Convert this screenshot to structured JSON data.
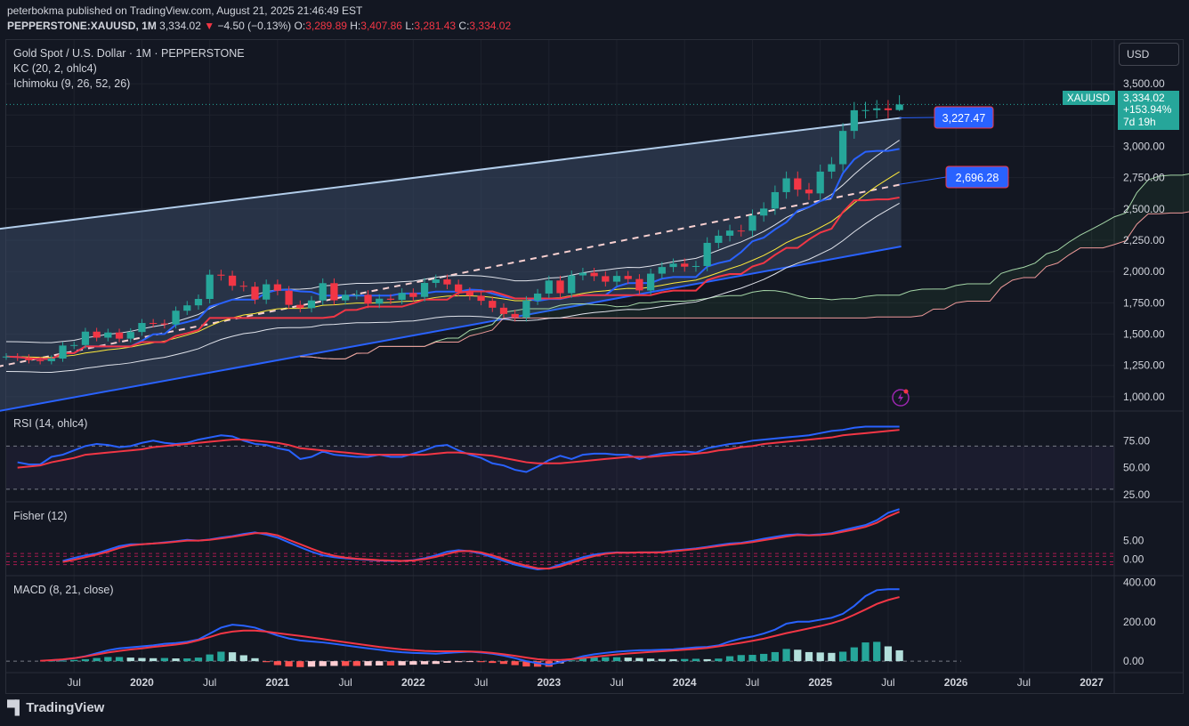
{
  "header": {
    "published_line": "peterbokma published on TradingView.com, August 21, 2025 21:46:49 EST",
    "symbol": "PEPPERSTONE:XAUUSD, 1M",
    "last": "3,334.02",
    "change_arrow": "▼",
    "change": "−4.50 (−0.13%)",
    "o_label": "O:",
    "o_value": "3,289.89",
    "h_label": "H:",
    "h_value": "3,407.86",
    "l_label": "L:",
    "l_value": "3,281.43",
    "c_label": "C:",
    "c_value": "3,334.02"
  },
  "legend": {
    "title": "Gold Spot / U.S. Dollar · 1M · PEPPERSTONE",
    "kc": "KC (20, 2, ohlc4)",
    "ichimoku": "Ichimoku (9, 26, 52, 26)",
    "rsi": "RSI (14, ohlc4)",
    "fisher": "Fisher (12)",
    "macd": "MACD (8, 21, close)"
  },
  "currency_button": "USD",
  "price_tag": {
    "symbol": "XAUUSD",
    "price": "3,334.02",
    "change_pct": "+153.94%",
    "countdown": "7d 19h"
  },
  "annotations": {
    "upper_line_value": "3,227.47",
    "mid_line_value": "2,696.28"
  },
  "colors": {
    "background": "#131722",
    "up": "#26a69a",
    "down": "#f23645",
    "blue_line": "#2962ff",
    "red_line": "#f23645",
    "channel_upper": "#b2cdea",
    "channel_fill": "#3a4a66"
  },
  "footer": {
    "logo_text": "TradingView"
  },
  "chart_data": [
    {
      "type": "candlestick",
      "title": "Gold Spot / U.S. Dollar · 1M · PEPPERSTONE",
      "ylim": [
        900,
        3600
      ],
      "y_ticks": [
        "3,500.00",
        "3,250.00",
        "3,000.00",
        "2,750.00",
        "2,500.00",
        "2,250.00",
        "2,000.00",
        "1,750.00",
        "1,500.00",
        "1,250.00",
        "1,000.00"
      ],
      "y_tick_values": [
        3500,
        3250,
        3000,
        2750,
        2500,
        2250,
        2000,
        1750,
        1500,
        1250,
        1000
      ],
      "x_ticks": [
        "Jul",
        "2020",
        "Jul",
        "2021",
        "Jul",
        "2022",
        "Jul",
        "2023",
        "Jul",
        "2024",
        "Jul",
        "2025",
        "Jul",
        "2026",
        "Jul",
        "2027"
      ],
      "x_tick_months": [
        "2019-07",
        "2020-01",
        "2020-07",
        "2021-01",
        "2021-07",
        "2022-01",
        "2022-07",
        "2023-01",
        "2023-07",
        "2024-01",
        "2024-07",
        "2025-01",
        "2025-07",
        "2026-01",
        "2026-07",
        "2027-01"
      ],
      "x_range": [
        "2019-01",
        "2027-03"
      ],
      "closes": [
        {
          "month": "2019-01",
          "close": 1321
        },
        {
          "month": "2019-02",
          "close": 1313
        },
        {
          "month": "2019-03",
          "close": 1292
        },
        {
          "month": "2019-04",
          "close": 1284
        },
        {
          "month": "2019-05",
          "close": 1305
        },
        {
          "month": "2019-06",
          "close": 1409
        },
        {
          "month": "2019-07",
          "close": 1413
        },
        {
          "month": "2019-08",
          "close": 1520
        },
        {
          "month": "2019-09",
          "close": 1472
        },
        {
          "month": "2019-10",
          "close": 1513
        },
        {
          "month": "2019-11",
          "close": 1464
        },
        {
          "month": "2019-12",
          "close": 1517
        },
        {
          "month": "2020-01",
          "close": 1589
        },
        {
          "month": "2020-02",
          "close": 1585
        },
        {
          "month": "2020-03",
          "close": 1577
        },
        {
          "month": "2020-04",
          "close": 1687
        },
        {
          "month": "2020-05",
          "close": 1730
        },
        {
          "month": "2020-06",
          "close": 1781
        },
        {
          "month": "2020-07",
          "close": 1975
        },
        {
          "month": "2020-08",
          "close": 1967
        },
        {
          "month": "2020-09",
          "close": 1886
        },
        {
          "month": "2020-10",
          "close": 1879
        },
        {
          "month": "2020-11",
          "close": 1776
        },
        {
          "month": "2020-12",
          "close": 1898
        },
        {
          "month": "2021-01",
          "close": 1847
        },
        {
          "month": "2021-02",
          "close": 1734
        },
        {
          "month": "2021-03",
          "close": 1708
        },
        {
          "month": "2021-04",
          "close": 1769
        },
        {
          "month": "2021-05",
          "close": 1907
        },
        {
          "month": "2021-06",
          "close": 1770
        },
        {
          "month": "2021-07",
          "close": 1814
        },
        {
          "month": "2021-08",
          "close": 1814
        },
        {
          "month": "2021-09",
          "close": 1743
        },
        {
          "month": "2021-10",
          "close": 1783
        },
        {
          "month": "2021-11",
          "close": 1774
        },
        {
          "month": "2021-12",
          "close": 1829
        },
        {
          "month": "2022-01",
          "close": 1797
        },
        {
          "month": "2022-02",
          "close": 1909
        },
        {
          "month": "2022-03",
          "close": 1937
        },
        {
          "month": "2022-04",
          "close": 1897
        },
        {
          "month": "2022-05",
          "close": 1837
        },
        {
          "month": "2022-06",
          "close": 1807
        },
        {
          "month": "2022-07",
          "close": 1766
        },
        {
          "month": "2022-08",
          "close": 1711
        },
        {
          "month": "2022-09",
          "close": 1661
        },
        {
          "month": "2022-10",
          "close": 1633
        },
        {
          "month": "2022-11",
          "close": 1768
        },
        {
          "month": "2022-12",
          "close": 1824
        },
        {
          "month": "2023-01",
          "close": 1928
        },
        {
          "month": "2023-02",
          "close": 1827
        },
        {
          "month": "2023-03",
          "close": 1969
        },
        {
          "month": "2023-04",
          "close": 1990
        },
        {
          "month": "2023-05",
          "close": 1963
        },
        {
          "month": "2023-06",
          "close": 1919
        },
        {
          "month": "2023-07",
          "close": 1965
        },
        {
          "month": "2023-08",
          "close": 1940
        },
        {
          "month": "2023-09",
          "close": 1849
        },
        {
          "month": "2023-10",
          "close": 1983
        },
        {
          "month": "2023-11",
          "close": 2036
        },
        {
          "month": "2023-12",
          "close": 2063
        },
        {
          "month": "2024-01",
          "close": 2039
        },
        {
          "month": "2024-02",
          "close": 2044
        },
        {
          "month": "2024-03",
          "close": 2229
        },
        {
          "month": "2024-04",
          "close": 2286
        },
        {
          "month": "2024-05",
          "close": 2327
        },
        {
          "month": "2024-06",
          "close": 2326
        },
        {
          "month": "2024-07",
          "close": 2447
        },
        {
          "month": "2024-08",
          "close": 2503
        },
        {
          "month": "2024-09",
          "close": 2634
        },
        {
          "month": "2024-10",
          "close": 2744
        },
        {
          "month": "2024-11",
          "close": 2654
        },
        {
          "month": "2024-12",
          "close": 2624
        },
        {
          "month": "2025-01",
          "close": 2798
        },
        {
          "month": "2025-02",
          "close": 2857
        },
        {
          "month": "2025-03",
          "close": 3123
        },
        {
          "month": "2025-04",
          "close": 3288
        },
        {
          "month": "2025-05",
          "close": 3289
        },
        {
          "month": "2025-06",
          "close": 3303
        },
        {
          "month": "2025-07",
          "close": 3289
        },
        {
          "month": "2025-08",
          "close": 3334
        }
      ],
      "last_candle": {
        "open": 3289.89,
        "high": 3407.86,
        "low": 3281.43,
        "close": 3334.02
      }
    },
    {
      "type": "line",
      "title": "RSI (14, ohlc4)",
      "ylim": [
        20,
        100
      ],
      "y_ticks": [
        "75.00",
        "50.00",
        "25.00"
      ],
      "y_tick_values": [
        75,
        50,
        25
      ],
      "band": [
        30,
        70
      ],
      "series": [
        {
          "values": [
            55,
            53,
            53,
            60,
            62,
            66,
            70,
            72,
            71,
            69,
            70,
            73,
            75,
            73,
            72,
            73,
            76,
            78,
            80,
            79,
            75,
            72,
            71,
            68,
            66,
            58,
            60,
            65,
            62,
            61,
            60,
            60,
            62,
            60,
            60,
            63,
            66,
            70,
            71,
            66,
            62,
            59,
            54,
            52,
            48,
            46,
            51,
            57,
            61,
            58,
            62,
            63,
            63,
            62,
            62,
            58,
            61,
            63,
            64,
            65,
            64,
            68,
            70,
            72,
            73,
            75,
            76,
            77,
            78,
            79,
            80,
            82,
            84,
            85,
            87,
            88,
            88,
            88,
            88
          ]
        },
        {
          "values": [
            50,
            51,
            52,
            55,
            57,
            59,
            62,
            63,
            64,
            65,
            66,
            67,
            69,
            70,
            71,
            72,
            73,
            74,
            75,
            76,
            76,
            75,
            74,
            73,
            71,
            68,
            67,
            66,
            65,
            64,
            63,
            62,
            62,
            62,
            62,
            62,
            62,
            63,
            64,
            64,
            63,
            62,
            61,
            59,
            57,
            55,
            54,
            54,
            54,
            55,
            56,
            57,
            58,
            59,
            60,
            60,
            60,
            61,
            62,
            62,
            63,
            64,
            66,
            67,
            69,
            70,
            72,
            73,
            74,
            75,
            76,
            77,
            78,
            80,
            81,
            82,
            83,
            84,
            85
          ]
        }
      ]
    },
    {
      "type": "line",
      "title": "Fisher (12)",
      "ylim": [
        -4,
        15
      ],
      "y_ticks": [
        "5.00",
        "0.00"
      ],
      "y_tick_values": [
        5,
        0
      ],
      "levels": [
        1.5,
        0.75,
        -0.75,
        -1.5
      ],
      "series": [
        {
          "values": [
            -0.5,
            0.3,
            1.0,
            1.5,
            2.5,
            3.5,
            4.0,
            4.0,
            4.2,
            4.5,
            4.8,
            5.2,
            5.0,
            5.3,
            5.8,
            6.2,
            6.8,
            7.2,
            6.6,
            5.8,
            4.5,
            3.2,
            2.0,
            1.0,
            0.5,
            0.2,
            0.0,
            -0.2,
            -0.4,
            -0.5,
            -0.5,
            -0.3,
            0.2,
            1.0,
            2.0,
            2.4,
            2.1,
            1.5,
            0.5,
            -0.5,
            -1.5,
            -2.2,
            -2.8,
            -2.5,
            -1.5,
            -0.5,
            0.5,
            1.2,
            1.6,
            1.8,
            1.7,
            1.8,
            1.8,
            1.9,
            2.3,
            2.6,
            2.9,
            3.3,
            3.8,
            4.2,
            4.4,
            4.9,
            5.5,
            6.0,
            6.5,
            6.7,
            6.5,
            6.7,
            7.0,
            7.8,
            8.5,
            9.2,
            10.5,
            12.5,
            13.5
          ]
        },
        {
          "values": [
            -0.8,
            -0.2,
            0.5,
            1.2,
            2.0,
            3.0,
            3.7,
            4.0,
            4.2,
            4.4,
            4.7,
            5.0,
            5.0,
            5.2,
            5.6,
            6.0,
            6.5,
            7.0,
            7.0,
            6.4,
            5.2,
            4.0,
            2.8,
            1.7,
            0.9,
            0.4,
            0.1,
            -0.1,
            -0.3,
            -0.4,
            -0.5,
            -0.4,
            0.0,
            0.6,
            1.4,
            2.1,
            2.2,
            1.8,
            1.0,
            0.0,
            -1.0,
            -1.8,
            -2.5,
            -2.6,
            -2.0,
            -1.0,
            0.0,
            0.8,
            1.4,
            1.7,
            1.7,
            1.8,
            1.8,
            1.8,
            2.1,
            2.4,
            2.7,
            3.1,
            3.5,
            3.9,
            4.2,
            4.6,
            5.1,
            5.6,
            6.1,
            6.5,
            6.4,
            6.5,
            6.8,
            7.4,
            8.0,
            8.7,
            9.8,
            11.5,
            12.8
          ]
        }
      ]
    },
    {
      "type": "line",
      "title": "MACD (8, 21, close)",
      "ylim": [
        -40,
        420
      ],
      "y_ticks": [
        "400.00",
        "200.00",
        "0.00"
      ],
      "y_tick_values": [
        400,
        200,
        0
      ],
      "series": [
        {
          "values": [
            5,
            8,
            15,
            25,
            40,
            55,
            65,
            70,
            75,
            80,
            88,
            92,
            98,
            110,
            140,
            170,
            185,
            180,
            170,
            150,
            130,
            115,
            105,
            100,
            95,
            88,
            80,
            72,
            65,
            58,
            50,
            45,
            42,
            40,
            38,
            42,
            45,
            48,
            44,
            38,
            28,
            15,
            0,
            -10,
            -18,
            -5,
            10,
            25,
            35,
            42,
            48,
            52,
            55,
            56,
            58,
            60,
            65,
            70,
            72,
            80,
            100,
            115,
            125,
            140,
            160,
            190,
            200,
            200,
            210,
            220,
            240,
            280,
            330,
            360,
            365,
            365
          ]
        },
        {
          "values": [
            2,
            5,
            9,
            15,
            24,
            34,
            44,
            52,
            59,
            65,
            72,
            78,
            84,
            92,
            106,
            122,
            140,
            150,
            155,
            155,
            150,
            142,
            135,
            128,
            120,
            112,
            104,
            96,
            88,
            80,
            72,
            66,
            60,
            56,
            52,
            50,
            50,
            50,
            49,
            47,
            42,
            35,
            27,
            18,
            10,
            6,
            6,
            10,
            16,
            22,
            28,
            34,
            39,
            43,
            47,
            50,
            54,
            58,
            62,
            67,
            75,
            84,
            93,
            103,
            114,
            128,
            142,
            154,
            166,
            178,
            192,
            210,
            235,
            262,
            290,
            310,
            325
          ]
        }
      ],
      "histogram": [
        3,
        3,
        6,
        10,
        16,
        21,
        21,
        18,
        16,
        15,
        16,
        14,
        14,
        18,
        34,
        48,
        45,
        30,
        15,
        -5,
        -20,
        -27,
        -30,
        -28,
        -25,
        -24,
        -24,
        -24,
        -23,
        -22,
        -22,
        -21,
        -18,
        -16,
        -14,
        -8,
        -5,
        -2,
        -5,
        -9,
        -14,
        -20,
        -27,
        -28,
        -28,
        -11,
        4,
        15,
        19,
        20,
        20,
        18,
        16,
        13,
        11,
        10,
        11,
        12,
        10,
        13,
        25,
        31,
        32,
        37,
        46,
        62,
        58,
        46,
        44,
        42,
        48,
        70,
        95,
        98,
        75,
        55
      ]
    }
  ]
}
